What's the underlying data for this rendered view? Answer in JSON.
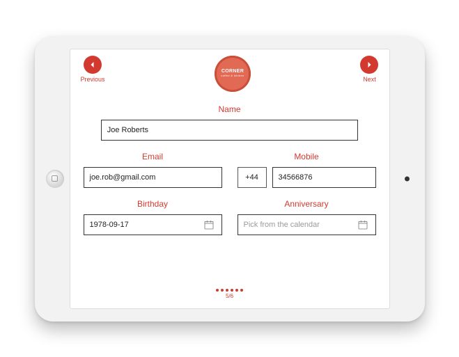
{
  "nav": {
    "prev_label": "Previous",
    "next_label": "Next"
  },
  "logo": {
    "title": "CORNER",
    "subtitle": "coffee & kitchen"
  },
  "form": {
    "name_label": "Name",
    "name_value": "Joe Roberts",
    "email_label": "Email",
    "email_value": "joe.rob@gmail.com",
    "mobile_label": "Mobile",
    "mobile_code": "+44",
    "mobile_value": "34566876",
    "birthday_label": "Birthday",
    "birthday_value": "1978-09-17",
    "anniversary_label": "Anniversary",
    "anniversary_placeholder": "Pick from the calendar"
  },
  "footer": {
    "page_indicator": "5/6"
  }
}
